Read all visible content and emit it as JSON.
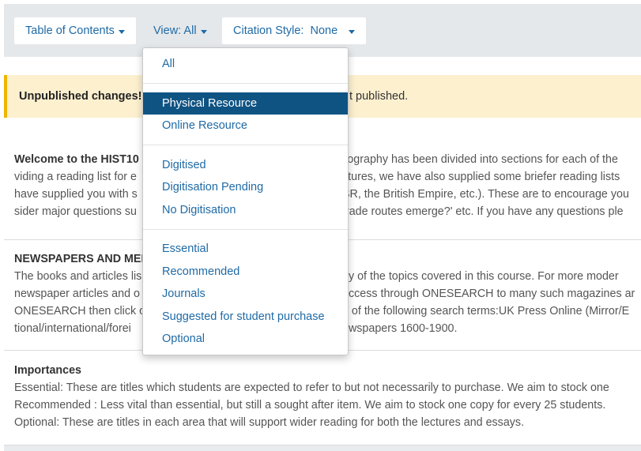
{
  "toolbar": {
    "toc_label": "Table of Contents",
    "view_label": "View: All",
    "citation_label": "Citation Style:  None"
  },
  "banner": {
    "strong_text": "Unpublished changes!",
    "rest_text": "t published."
  },
  "welcome": {
    "line1_bold": "Welcome to the HIST10",
    "line1_right": "liography has been divided into sections for each of the",
    "line2_left": "viding a reading list for e",
    "line2_right": "ctures, we have also supplied some briefer reading lists",
    "line3_left": "have supplied you with s",
    "line3_right": "SR, the British Empire, etc.). These are to encourage you",
    "line4_left": "sider major questions su",
    "line4_right": "trade routes emerge?' etc. If you have any questions ple"
  },
  "newspapers": {
    "title": "NEWSPAPERS AND MED",
    "line1_left": "The books and articles lis",
    "line1_right": "ny of the topics covered in this course. For more moder",
    "line2_left": "newspaper articles and o",
    "line2_right": "access through ONESEARCH to many such magazines ar",
    "line3_left": "ONESEARCH then click o",
    "line3_right": "e of the following search terms:UK Press Online (Mirror/E",
    "line4_left": "tional/international/forei",
    "line4_right": "ewspapers 1600-1900."
  },
  "importances": {
    "title": "Importances",
    "line1": "Essential: These are titles which students are expected to refer to but not necessarily to purchase.  We aim to stock one",
    "line2": "Recommended : Less vital than essential, but still a sought after item.  We aim to stock one copy for every 25 students.",
    "line3": "Optional: These are titles in each area that will support wider reading for both the lectures and essays."
  },
  "view_dropdown": {
    "selected": "Physical Resource",
    "items": [
      "All",
      "Physical Resource",
      "Online Resource",
      "Digitised",
      "Digitisation Pending",
      "No Digitisation",
      "Essential",
      "Recommended",
      "Journals",
      "Suggested for student purchase",
      "Optional"
    ]
  },
  "colors": {
    "link": "#1f6aa5",
    "active_bg": "#0f5383",
    "banner_bg": "#fcf0cf",
    "banner_accent": "#f0b400",
    "toolbar_bg": "#e5e8eb"
  }
}
